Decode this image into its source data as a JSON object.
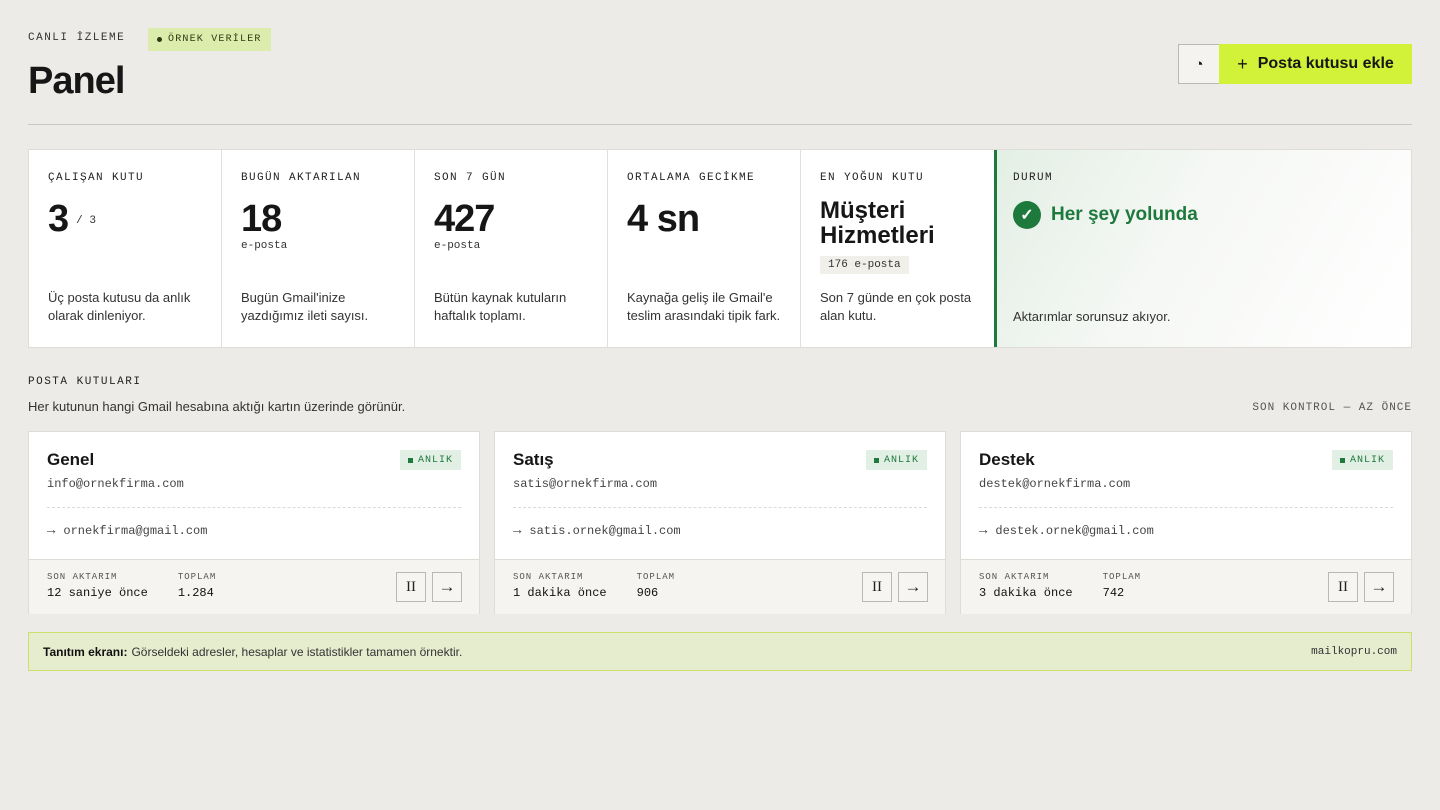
{
  "header": {
    "eyebrow": "CANLI İZLEME",
    "sample_badge": "ÖRNEK VERİLER",
    "title": "Panel",
    "refresh_icon": "◔",
    "add_button_label": "Posta kutusu ekle",
    "add_button_icon": "+"
  },
  "stats": [
    {
      "label": "ÇALIŞAN KUTU",
      "value": "3",
      "denominator": "/ 3",
      "unit": "",
      "description": "Üç posta kutusu da anlık olarak dinleniyor."
    },
    {
      "label": "BUGÜN AKTARILAN",
      "value": "18",
      "unit": "e-posta",
      "description": "Bugün Gmail'inize yazdığımız ileti sayısı."
    },
    {
      "label": "SON 7 GÜN",
      "value": "427",
      "unit": "e-posta",
      "description": "Bütün kaynak kutuların haftalık toplamı."
    },
    {
      "label": "ORTALAMA GECİKME",
      "value": "4 sn",
      "unit": "",
      "description": "Kaynağa geliş ile Gmail'e teslim arasındaki tipik fark."
    },
    {
      "label": "EN YOĞUN KUTU",
      "value": "Müşteri Hizmetleri",
      "chip": "176 e-posta",
      "description": "Son 7 günde en çok posta alan kutu."
    }
  ],
  "status": {
    "label": "DURUM",
    "text": "Her şey yolunda",
    "icon": "✓",
    "description": "Aktarımlar sorunsuz akıyor.",
    "color": "#1e7a3c"
  },
  "mailboxes_section": {
    "label": "POSTA KUTULARI",
    "description": "Her kutunun hangi Gmail hesabına aktığı kartın üzerinde görünür.",
    "last_check": "SON KONTROL — AZ ÖNCE"
  },
  "mailboxes": [
    {
      "name": "Genel",
      "badge": "ANLIK",
      "email": "info@ornekfirma.com",
      "target": "ornekfirma@gmail.com",
      "last_label": "SON AKTARIM",
      "last_value": "12 saniye önce",
      "total_label": "TOPLAM",
      "total_value": "1.284"
    },
    {
      "name": "Satış",
      "badge": "ANLIK",
      "email": "satis@ornekfirma.com",
      "target": "satis.ornek@gmail.com",
      "last_label": "SON AKTARIM",
      "last_value": "1 dakika önce",
      "total_label": "TOPLAM",
      "total_value": "906"
    },
    {
      "name": "Destek",
      "badge": "ANLIK",
      "email": "destek@ornekfirma.com",
      "target": "destek.ornek@gmail.com",
      "last_label": "SON AKTARIM",
      "last_value": "3 dakika önce",
      "total_label": "TOPLAM",
      "total_value": "742"
    }
  ],
  "card_icons": {
    "arrow": "→",
    "pause": "II",
    "go": "→"
  },
  "demo_note": {
    "title": "Tanıtım ekranı:",
    "text": "Görseldeki adresler, hesaplar ve istatistikler tamamen örnektir.",
    "domain": "mailkopru.com"
  },
  "colors": {
    "accent": "#d2f23a",
    "success": "#1e7a3c",
    "background": "#ecebe7"
  }
}
